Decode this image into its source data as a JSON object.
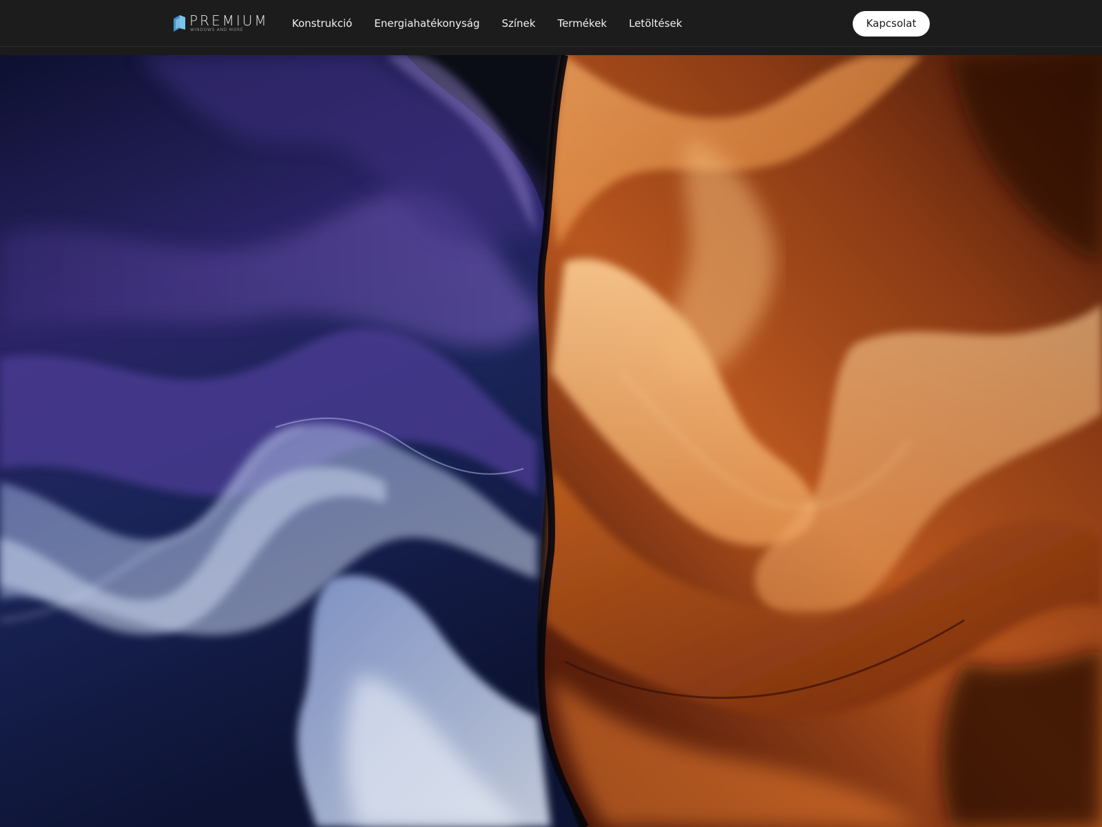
{
  "brand": {
    "name": "PREMIUM",
    "tagline": "WINDOWS AND MORE",
    "mark_icon": "window-cube-icon",
    "mark_color": "#5aa7d6"
  },
  "nav": {
    "items": [
      {
        "label": "Konstrukció"
      },
      {
        "label": "Energiahatékonyság"
      },
      {
        "label": "Színek"
      },
      {
        "label": "Termékek"
      },
      {
        "label": "Letöltések"
      }
    ],
    "contact_label": "Kapcsolat"
  },
  "colors": {
    "navbar_bg": "#1c1c1c",
    "nav_text": "#f2f2f2",
    "button_bg": "#ffffff",
    "button_text": "#1a1a1a",
    "hero_cool": "#4a3f8f",
    "hero_warm": "#c8622a"
  }
}
